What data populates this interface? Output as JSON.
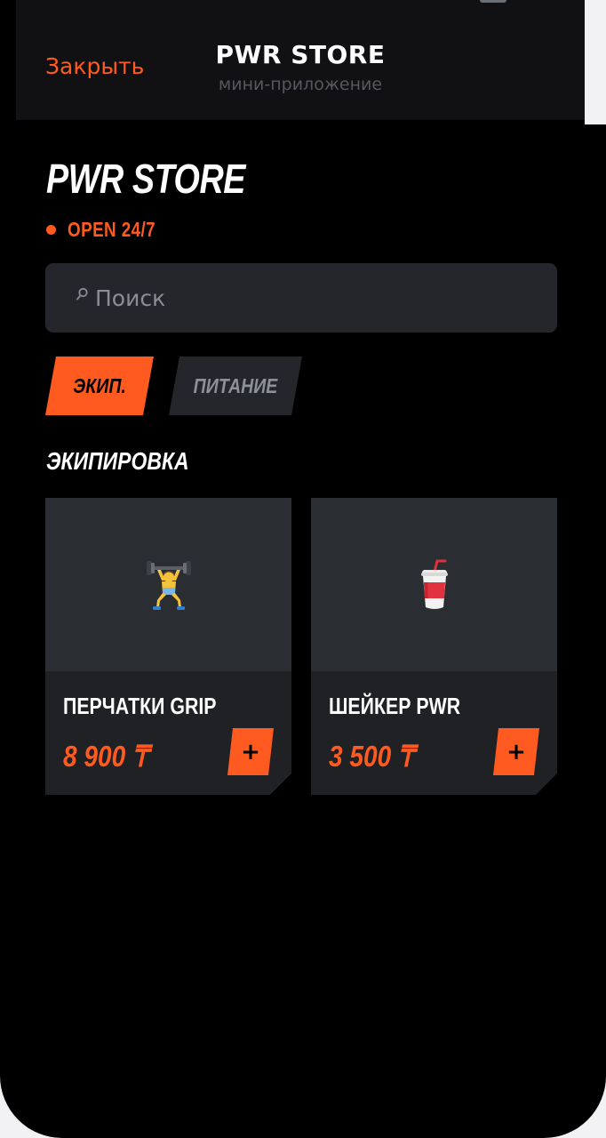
{
  "header": {
    "close_label": "Закрыть",
    "title": "PWR STORE",
    "subtitle": "мини-приложение"
  },
  "store": {
    "title": "PWR STORE",
    "status": "OPEN 24/7"
  },
  "search": {
    "placeholder": "Поиск",
    "value": ""
  },
  "categories": [
    {
      "label": "ЭКИП.",
      "active": true
    },
    {
      "label": "ПИТАНИЕ",
      "active": false
    }
  ],
  "section": {
    "title": "ЭКИПИРОВКА"
  },
  "products": [
    {
      "icon": "weightlifter-icon",
      "name": "ПЕРЧАТКИ GRIP",
      "price": "8 900 ₸",
      "add_label": "+"
    },
    {
      "icon": "cup-with-straw-icon",
      "name": "ШЕЙКЕР PWR",
      "price": "3 500 ₸",
      "add_label": "+"
    }
  ],
  "colors": {
    "accent": "#ff5a1f",
    "background": "#000000",
    "surface": "#24262b",
    "card_image_bg": "#2a2d31",
    "card_bottom_bg": "#1f2125"
  }
}
